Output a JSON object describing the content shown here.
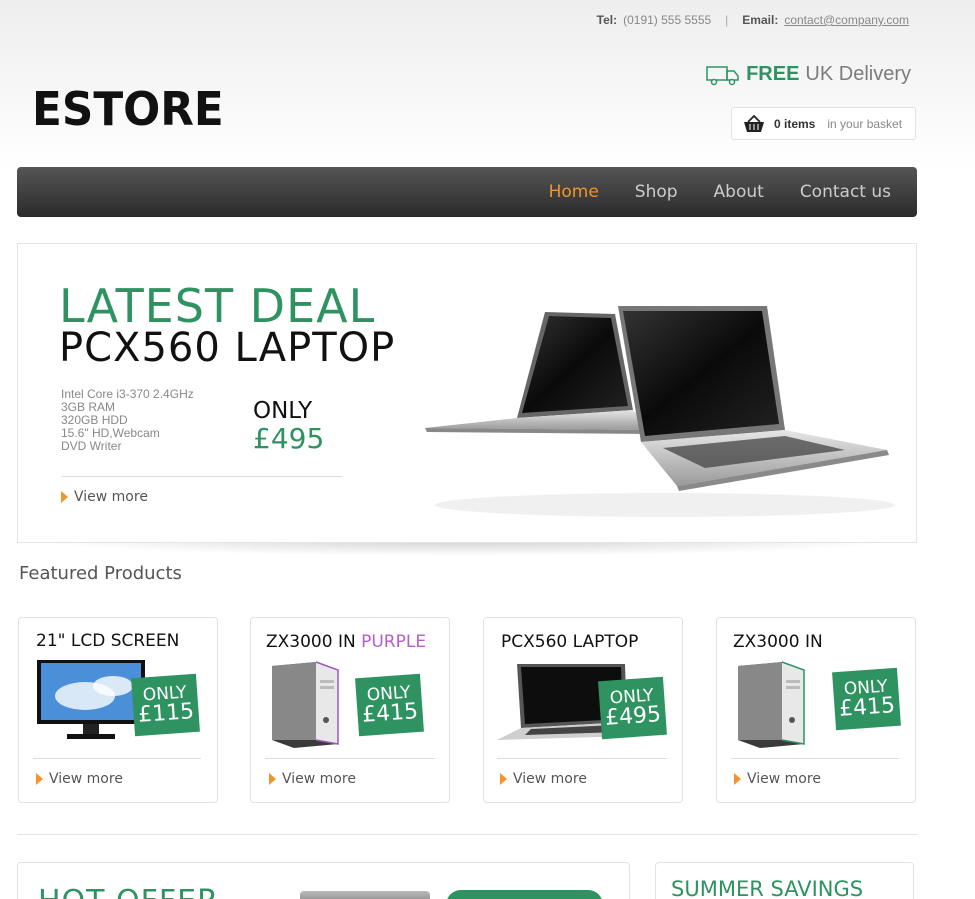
{
  "header": {
    "tel_label": "Tel:",
    "tel_value": "(0191) 555 5555",
    "separator": "|",
    "email_label": "Email:",
    "email_value": "contact@company.com",
    "logo": "ESTORE",
    "delivery_free": "FREE",
    "delivery_rest": "UK Delivery",
    "basket_count": "0 items",
    "basket_label": "in your basket"
  },
  "nav": {
    "items": [
      "Home",
      "Shop",
      "About",
      "Contact us"
    ],
    "active": "Home"
  },
  "hero": {
    "title1": "LATEST DEAL",
    "title2": "PCX560 LAPTOP",
    "specs": [
      "Intel Core i3-370 2.4GHz",
      "3GB RAM",
      "320GB HDD",
      "15.6\" HD,Webcam",
      "DVD Writer"
    ],
    "only": "ONLY",
    "price": "£495",
    "view_more": "View more"
  },
  "featured": {
    "title": "Featured Products",
    "products": [
      {
        "name": "21\" LCD SCREEN",
        "accent": "",
        "only": "ONLY",
        "price": "£115",
        "view_more": "View more",
        "image": "monitor"
      },
      {
        "name": "ZX3000 IN",
        "accent": "PURPLE",
        "only": "ONLY",
        "price": "£415",
        "view_more": "View more",
        "image": "pc-tower-purple"
      },
      {
        "name": "PCX560 LAPTOP",
        "accent": "",
        "only": "ONLY",
        "price": "£495",
        "view_more": "View more",
        "image": "laptop"
      },
      {
        "name": "ZX3000 IN",
        "accent": "",
        "only": "ONLY",
        "price": "£415",
        "view_more": "View more",
        "image": "pc-tower-green"
      }
    ]
  },
  "bottom": {
    "hot_offer": "HOT OFFER",
    "summer_savings": "SUMMER SAVINGS"
  },
  "colors": {
    "brand_green": "#2e9361",
    "nav_active": "#f0952b",
    "accent_purple": "#b55ec9"
  }
}
